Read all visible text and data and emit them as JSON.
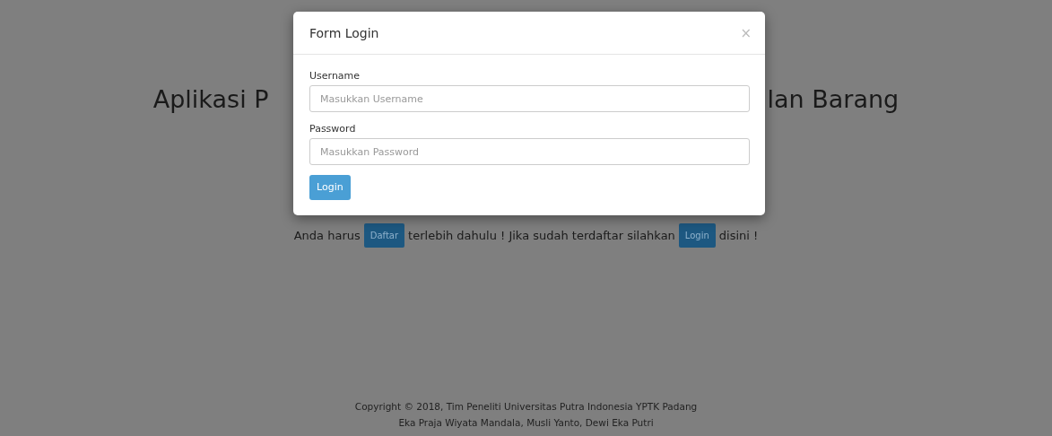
{
  "page": {
    "heading_parts": [
      "Aplikasi P",
      "lan Barang"
    ],
    "notice": [
      {
        "kind": "text",
        "text": "Anda harus"
      },
      {
        "kind": "button",
        "text": "Daftar"
      },
      {
        "kind": "text",
        "text": "terlebih dahulu ! Jika sudah terdaftar silahkan"
      },
      {
        "kind": "button",
        "text": "Login"
      },
      {
        "kind": "text",
        "text": "disini !"
      }
    ],
    "footer": [
      "Copyright © 2018, Tim Peneliti Universitas Putra Indonesia YPTK Padang",
      "Eka Praja Wiyata Mandala, Musli Yanto, Dewi Eka Putri"
    ]
  },
  "modal": {
    "title": "Form Login",
    "close": "×",
    "fields": [
      {
        "label": "Username",
        "placeholder": "Masukkan Username"
      },
      {
        "label": "Password",
        "placeholder": "Masukkan Password"
      }
    ],
    "submit": "Login"
  }
}
